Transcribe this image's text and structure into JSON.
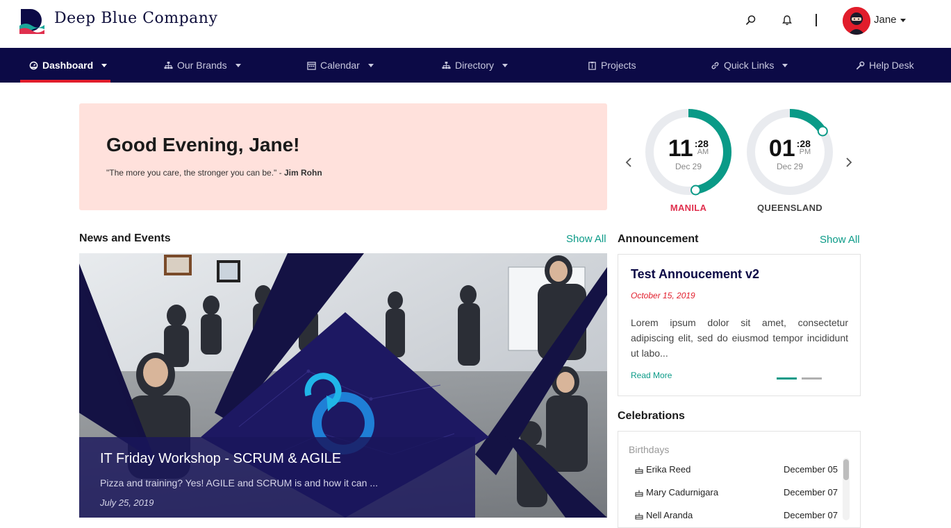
{
  "header": {
    "brand": "Deep Blue Company",
    "icons": [
      "search-icon",
      "bell-icon"
    ],
    "user": {
      "name": "Jane"
    }
  },
  "nav": {
    "items": [
      {
        "label": "Dashboard",
        "icon": "dashboard-icon",
        "dropdown": true,
        "active": true
      },
      {
        "label": "Our Brands",
        "icon": "sitemap-icon",
        "dropdown": true
      },
      {
        "label": "Calendar",
        "icon": "calendar-icon",
        "dropdown": true
      },
      {
        "label": "Directory",
        "icon": "sitemap-icon",
        "dropdown": true
      },
      {
        "label": "Projects",
        "icon": "clipboard-icon",
        "dropdown": false
      },
      {
        "label": "Quick Links",
        "icon": "link-icon",
        "dropdown": true
      },
      {
        "label": "Help Desk",
        "icon": "wrench-icon",
        "dropdown": false
      }
    ]
  },
  "greeting": {
    "title": "Good Evening, Jane!",
    "quote": "\"The more you care, the stronger you can be.\" -",
    "author": "Jim Rohn"
  },
  "clocks": [
    {
      "city": "MANILA",
      "hour": "11",
      "minute": ":28",
      "ampm": "AM",
      "date": "Dec 29",
      "progress": 0.47,
      "city_color": "#e0304e"
    },
    {
      "city": "QUEENSLAND",
      "hour": "01",
      "minute": ":28",
      "ampm": "PM",
      "date": "Dec 29",
      "progress": 0.16,
      "city_color": "#444444"
    }
  ],
  "news": {
    "heading": "News and Events",
    "show_all": "Show All",
    "title": "IT Friday Workshop - SCRUM & AGILE",
    "description": "Pizza and training? Yes! AGILE and SCRUM is and how it can ...",
    "date": "July 25, 2019"
  },
  "announcement": {
    "heading": "Announcement",
    "show_all": "Show All",
    "title": "Test Annoucement v2",
    "date": "October 15, 2019",
    "body": "Lorem ipsum dolor sit amet, consectetur adipiscing elit, sed do eiusmod tempor incididunt ut labo...",
    "read_more": "Read More",
    "active_slide": 1,
    "slides": 2
  },
  "celebrations": {
    "heading": "Celebrations",
    "subheading": "Birthdays",
    "items": [
      {
        "name": "Erika Reed",
        "date": "December 05"
      },
      {
        "name": "Mary Cadurnigara",
        "date": "December 07"
      },
      {
        "name": "Nell Aranda",
        "date": "December 07"
      }
    ]
  },
  "colors": {
    "navy": "#0c0a46",
    "accent_red": "#e11d2b",
    "teal": "#0a9a87",
    "greeting_bg": "#ffe1dc"
  }
}
